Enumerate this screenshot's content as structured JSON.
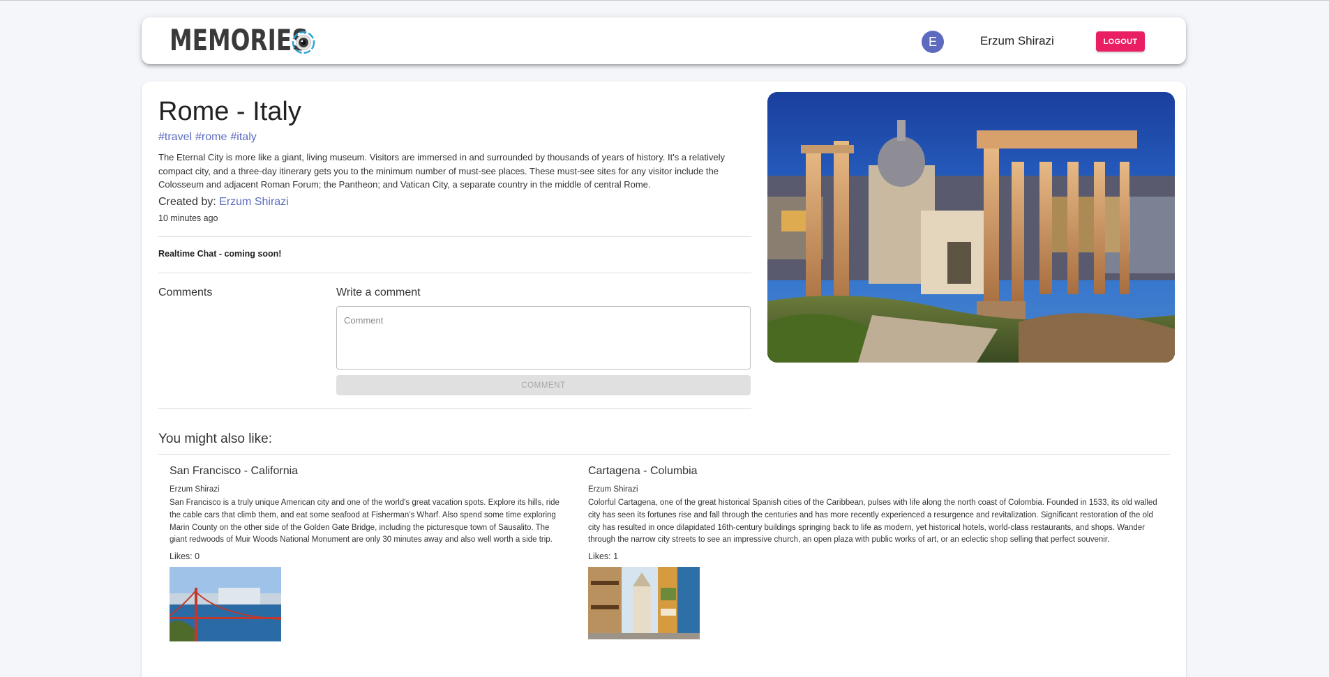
{
  "header": {
    "logo_text": "MEMORIES",
    "avatar_letter": "E",
    "user_name": "Erzum Shirazi",
    "logout_label": "LOGOUT"
  },
  "post": {
    "title": "Rome - Italy",
    "tags": [
      "#travel",
      "#rome",
      "#italy"
    ],
    "message": "The Eternal City is more like a giant, living museum. Visitors are immersed in and surrounded by thousands of years of history. It's a relatively compact city, and a three-day itinerary gets you to the minimum number of must-see places. These must-see sites for any visitor include the Colosseum and adjacent Roman Forum; the Pantheon; and Vatican City, a separate country in the middle of central Rome.",
    "created_label": "Created by: ",
    "creator": "Erzum Shirazi",
    "time_ago": "10 minutes ago"
  },
  "realtime_chat": "Realtime Chat - coming soon!",
  "comments": {
    "heading": "Comments",
    "write_heading": "Write a comment",
    "placeholder": "Comment",
    "button_label": "COMMENT"
  },
  "recommended": {
    "heading": "You might also like:",
    "items": [
      {
        "title": "San Francisco - California",
        "author": "Erzum Shirazi",
        "message": "San Francisco is a truly unique American city and one of the world's great vacation spots. Explore its hills, ride the cable cars that climb them, and eat some seafood at Fisherman's Wharf. Also spend some time exploring Marin County on the other side of the Golden Gate Bridge, including the picturesque town of Sausalito. The giant redwoods of Muir Woods National Monument are only 30 minutes away and also well worth a side trip.",
        "likes": "Likes: 0"
      },
      {
        "title": "Cartagena - Columbia",
        "author": "Erzum Shirazi",
        "message": "Colorful Cartagena, one of the great historical Spanish cities of the Caribbean, pulses with life along the north coast of Colombia. Founded in 1533, its old walled city has seen its fortunes rise and fall through the centuries and has more recently experienced a resurgence and revitalization. Significant restoration of the old city has resulted in once dilapidated 16th-century buildings springing back to life as modern, yet historical hotels, world-class restaurants, and shops. Wander through the narrow city streets to see an impressive church, an open plaza with public works of art, or an eclectic shop selling that perfect souvenir.",
        "likes": "Likes: 1"
      }
    ]
  },
  "colors": {
    "accent": "#5c6bc0",
    "logout": "#e91e63"
  }
}
